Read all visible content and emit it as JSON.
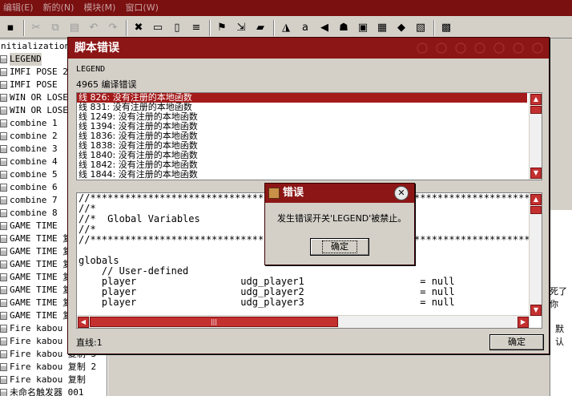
{
  "menu": [
    "编辑(E)",
    "新的(N)",
    "模块(M)",
    "窗口(W)"
  ],
  "toolbar_icons": [
    {
      "name": "save-icon",
      "glyph": "▪",
      "disabled": false
    },
    {
      "name": "cut-icon",
      "glyph": "✂",
      "disabled": true
    },
    {
      "name": "copy-icon",
      "glyph": "⧉",
      "disabled": true
    },
    {
      "name": "paste-icon",
      "glyph": "▤",
      "disabled": true
    },
    {
      "name": "undo-icon",
      "glyph": "↶",
      "disabled": true
    },
    {
      "name": "redo-icon",
      "glyph": "↷",
      "disabled": true
    },
    {
      "name": "delete-icon",
      "glyph": "✖",
      "disabled": false
    },
    {
      "name": "folder-icon",
      "glyph": "▭",
      "disabled": false
    },
    {
      "name": "new-file-icon",
      "glyph": "▯",
      "disabled": false
    },
    {
      "name": "list-icon",
      "glyph": "≡",
      "disabled": false
    },
    {
      "name": "flag-icon",
      "glyph": "⚑",
      "disabled": false
    },
    {
      "name": "import-icon",
      "glyph": "⇲",
      "disabled": false
    },
    {
      "name": "clapper-icon",
      "glyph": "▰",
      "disabled": false
    },
    {
      "name": "terrain-icon",
      "glyph": "◮",
      "disabled": false
    },
    {
      "name": "text-icon",
      "glyph": "a",
      "disabled": false
    },
    {
      "name": "sound-icon",
      "glyph": "◀",
      "disabled": false
    },
    {
      "name": "unit-icon",
      "glyph": "☗",
      "disabled": false
    },
    {
      "name": "object-icon",
      "glyph": "▣",
      "disabled": false
    },
    {
      "name": "ability-icon",
      "glyph": "▦",
      "disabled": false
    },
    {
      "name": "item-icon",
      "glyph": "◆",
      "disabled": false
    },
    {
      "name": "map-icon",
      "glyph": "▧",
      "disabled": false
    },
    {
      "name": "test-map-icon",
      "glyph": "▩",
      "disabled": false
    }
  ],
  "tree": {
    "items": [
      "nitialization",
      "LEGEND",
      "IMFI POSE 2",
      "IMFI POSE",
      "WIN OR LOSE",
      "WIN OR LOSE",
      "combine 1",
      "combine 2",
      "combine 3",
      "combine 4",
      "combine 5",
      "combine 6",
      "combine 7",
      "combine 8",
      "GAME TIME",
      "GAME TIME 复制",
      "GAME TIME 复制",
      "GAME TIME 复制",
      "GAME TIME 复制",
      "GAME TIME 复制",
      "GAME TIME 复制",
      "GAME TIME 复制",
      "Fire kabou",
      "Fire kabou 复制",
      "Fire kabou 复制 3",
      "Fire kabou 复制 2",
      "Fire kabou 复制",
      "未命名触发器 001"
    ]
  },
  "right_panel": {
    "text1": "死了你",
    "text2": "默认"
  },
  "dialog": {
    "title": "脚本错误",
    "trigger_name": "LEGEND",
    "error_count": "4965 编译错误",
    "errors": [
      "线 826: 没有注册的本地函数",
      "线 831: 没有注册的本地函数",
      "线 1249: 没有注册的本地函数",
      "线 1394: 没有注册的本地函数",
      "线 1836: 没有注册的本地函数",
      "线 1838: 没有注册的本地函数",
      "线 1840: 没有注册的本地函数",
      "线 1842: 没有注册的本地函数",
      "线 1844: 没有注册的本地函数"
    ],
    "code_lines": [
      "//*****************************************************************************************",
      "//*",
      "//*  Global Variables",
      "//*",
      "//*****************************************************************************************",
      "",
      "globals",
      "    // User-defined",
      "    player                  udg_player1                    = null",
      "    player                  udg_player2                    = null",
      "    player                  udg_player3                    = null"
    ],
    "status": "直线:1",
    "ok_label": "确定"
  },
  "error_popup": {
    "title": "错误",
    "message": "发生错误开关'LEGEND'被禁止。",
    "ok_label": "确定",
    "close_glyph": "✕"
  }
}
